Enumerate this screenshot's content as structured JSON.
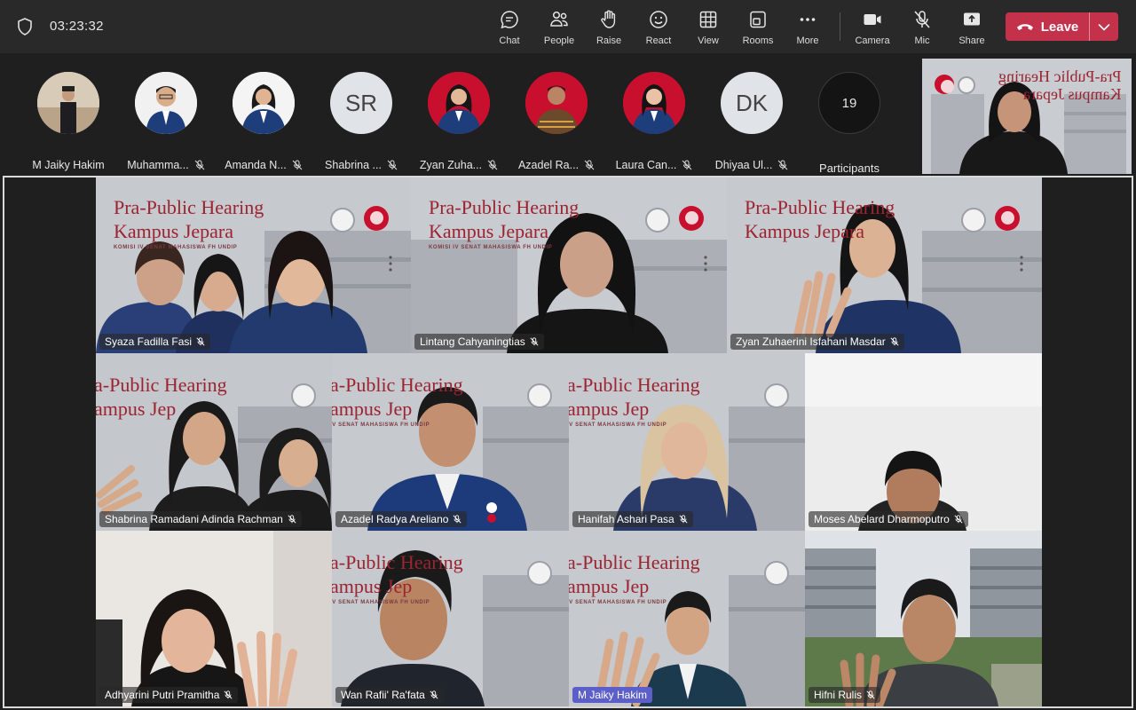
{
  "meeting": {
    "timer": "03:23:32",
    "toolbar": {
      "chat": "Chat",
      "people": "People",
      "raise": "Raise",
      "react": "React",
      "view": "View",
      "rooms": "Rooms",
      "more": "More",
      "camera": "Camera",
      "mic": "Mic",
      "share": "Share",
      "leave": "Leave"
    }
  },
  "strip": {
    "participants": [
      {
        "name": "M Jaiky Hakim"
      },
      {
        "name": "Muhamma..."
      },
      {
        "name": "Amanda N..."
      },
      {
        "name": "Shabrina ...",
        "initials": "SR"
      },
      {
        "name": "Zyan Zuha..."
      },
      {
        "name": "Azadel Ra..."
      },
      {
        "name": "Laura Can..."
      },
      {
        "name": "Dhiyaa Ul...",
        "initials": "DK"
      }
    ],
    "overflow": {
      "count": "19",
      "label": "Participants"
    }
  },
  "slide": {
    "title_line1": "Pra-Public Hearing",
    "title_line2": "Kampus Jepara",
    "subtitle": "KOMISI IV SENAT MAHASISWA FH UNDIP",
    "title_line1_cut": "a-Public Hearing",
    "title_line2_cut": "ampus Jep",
    "subtitle_cut": "IV SENAT MAHASISWA FH UNDIP"
  },
  "tiles": [
    {
      "name": "Syaza Fadilla Fasi"
    },
    {
      "name": "Lintang Cahyaningtias"
    },
    {
      "name": "Zyan Zuhaerini Isfahani Masdar"
    },
    {
      "name": "Shabrina Ramadani Adinda Rachman"
    },
    {
      "name": "Azadel Radya Areliano"
    },
    {
      "name": "Hanifah Ashari Pasa"
    },
    {
      "name": "Moses Abelard Dharmoputro"
    },
    {
      "name": "Adhyarini Putri Pramitha"
    },
    {
      "name": "Wan Rafii' Ra'fata"
    },
    {
      "name": "M Jaiky Hakim"
    },
    {
      "name": "Hifni Rulis"
    }
  ],
  "colors": {
    "leave": "#c4314b",
    "active_speaker_label": "#5b5fc7",
    "title_red": "#9c2330"
  }
}
